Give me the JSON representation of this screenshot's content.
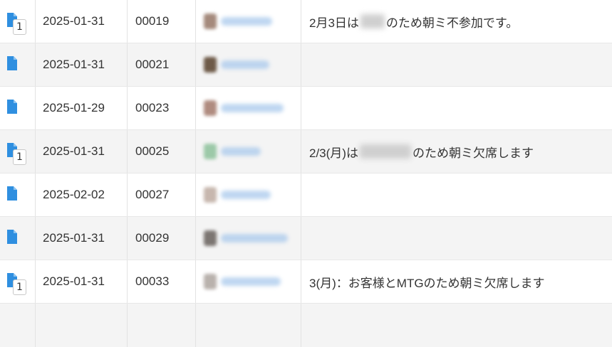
{
  "rows": [
    {
      "badge": "1",
      "date": "2025-01-31",
      "number": "00019",
      "note_before": "2月3日は",
      "note_after": "のため朝ミ不参加です。",
      "has_note": true
    },
    {
      "badge": "",
      "date": "2025-01-31",
      "number": "00021",
      "note_before": "",
      "note_after": "",
      "has_note": false
    },
    {
      "badge": "",
      "date": "2025-01-29",
      "number": "00023",
      "note_before": "",
      "note_after": "",
      "has_note": false
    },
    {
      "badge": "1",
      "date": "2025-01-31",
      "number": "00025",
      "note_before": "2/3(月)は",
      "note_after": "のため朝ミ欠席します",
      "has_note": true
    },
    {
      "badge": "",
      "date": "2025-02-02",
      "number": "00027",
      "note_before": "",
      "note_after": "",
      "has_note": false
    },
    {
      "badge": "",
      "date": "2025-01-31",
      "number": "00029",
      "note_before": "",
      "note_after": "",
      "has_note": false
    },
    {
      "badge": "1",
      "date": "2025-01-31",
      "number": "00033",
      "note_before": "3(月)：お客様とMTGのため朝ミ欠席します",
      "note_after": "",
      "has_note": true
    }
  ],
  "colors": {
    "doc_icon": "#2f8fe0",
    "row_alt_bg": "#f4f4f4",
    "text": "#333333"
  },
  "icons": {
    "document": "document-icon",
    "comment_badge": "comment-count-badge"
  }
}
